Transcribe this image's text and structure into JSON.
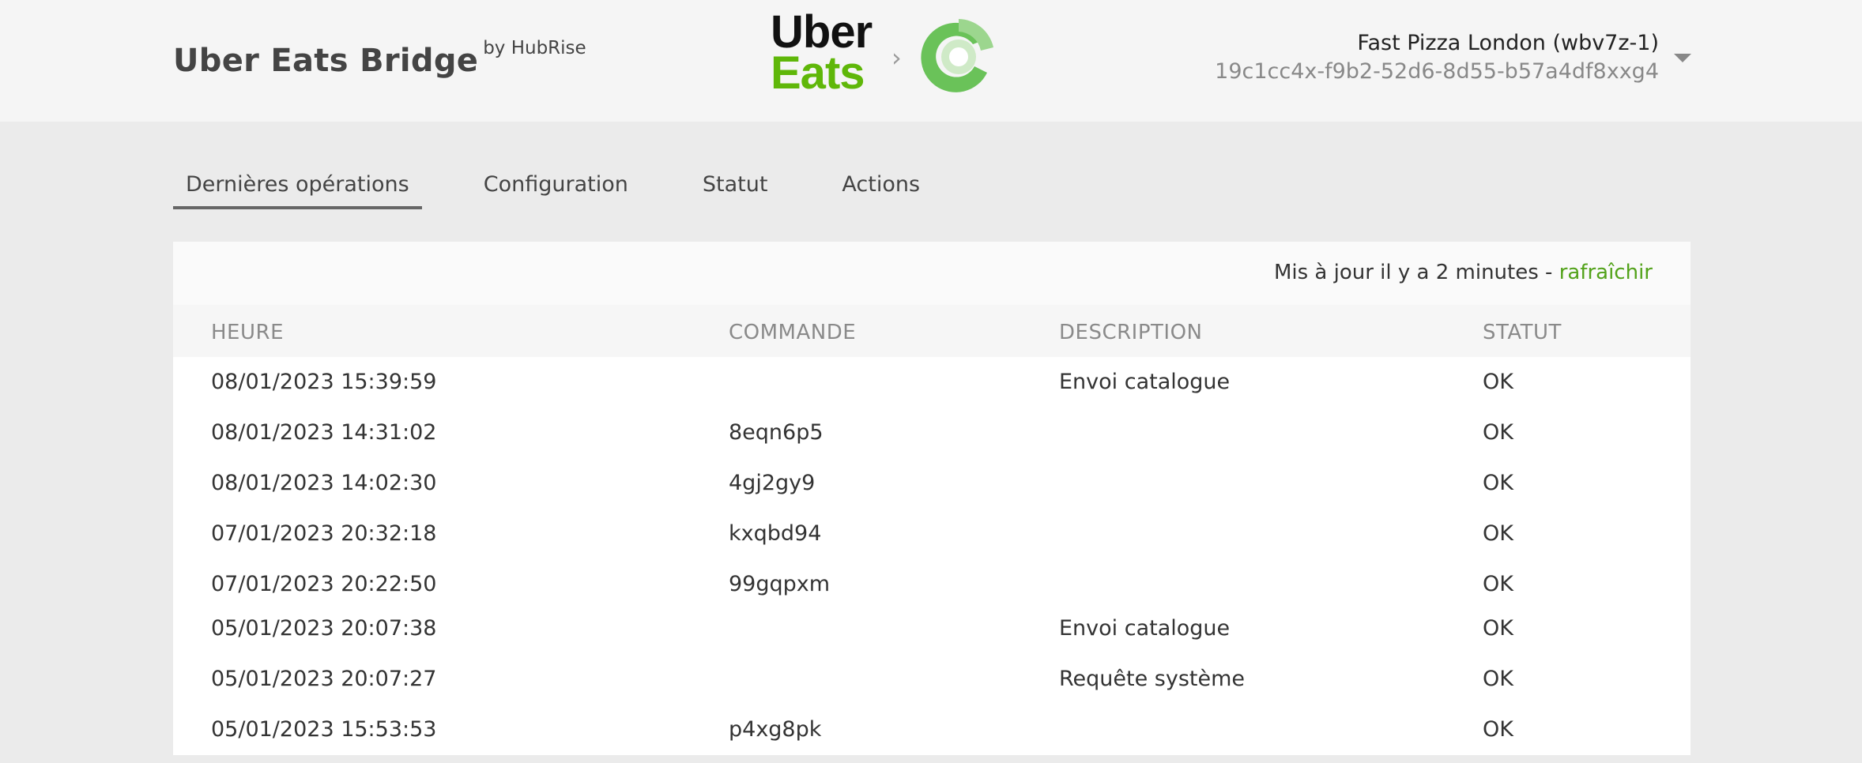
{
  "header": {
    "app_title": "Uber Eats Bridge",
    "by_text": "by HubRise",
    "uber_logo": {
      "line1": "Uber",
      "line2": "Eats",
      "icon": "uber-eats-logo"
    },
    "separator_icon": "chevron-right-icon",
    "hubrise_logo_icon": "hubrise-logo",
    "store_name": "Fast Pizza London (wbv7z-1)",
    "store_id": "19c1cc4x-f9b2-52d6-8d55-b57a4df8xxg4",
    "store_menu_icon": "caret-down-icon"
  },
  "tabs": [
    {
      "label": "Dernières opérations",
      "active": true
    },
    {
      "label": "Configuration",
      "active": false
    },
    {
      "label": "Statut",
      "active": false
    },
    {
      "label": "Actions",
      "active": false
    }
  ],
  "status": {
    "updated_text": "Mis à jour il y a 2 minutes - ",
    "refresh_label": "rafraîchir"
  },
  "table": {
    "columns": [
      "HEURE",
      "COMMANDE",
      "DESCRIPTION",
      "STATUT"
    ],
    "rows": [
      {
        "time": "08/01/2023 15:39:59",
        "order": "",
        "description": "Envoi catalogue",
        "status": "OK"
      },
      {
        "time": "08/01/2023 14:31:02",
        "order": "8eqn6p5",
        "description": "",
        "status": "OK"
      },
      {
        "time": "08/01/2023 14:02:30",
        "order": "4gj2gy9",
        "description": "",
        "status": "OK"
      },
      {
        "time": "07/01/2023 20:32:18",
        "order": "kxqbd94",
        "description": "",
        "status": "OK"
      },
      {
        "time": "07/01/2023 20:22:50",
        "order": "99gqpxm",
        "description": "",
        "status": "OK"
      },
      {
        "time": "05/01/2023 20:07:38",
        "order": "",
        "description": "Envoi catalogue",
        "status": "OK"
      },
      {
        "time": "05/01/2023 20:07:27",
        "order": "",
        "description": "Requête système",
        "status": "OK"
      },
      {
        "time": "05/01/2023 15:53:53",
        "order": "p4xg8pk",
        "description": "",
        "status": "OK"
      }
    ]
  },
  "colors": {
    "uber_green": "#5fb709",
    "hubrise_green": "#6ac259",
    "link_green": "#52a21a",
    "header_bg": "#f5f5f5",
    "page_bg": "#ebebeb"
  }
}
